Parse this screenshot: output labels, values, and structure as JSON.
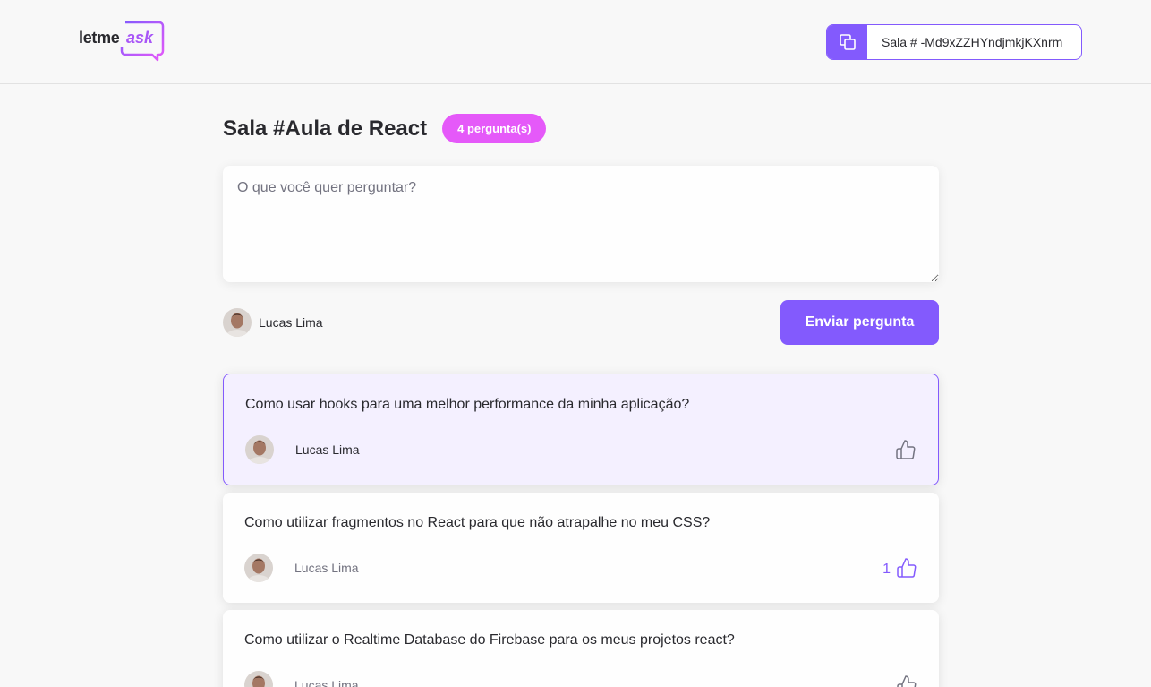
{
  "header": {
    "logo": {
      "part1": "letme",
      "part2": "ask"
    },
    "room_code": "Sala # -Md9xZZHYndjmkjKXnrm"
  },
  "room": {
    "title": "Sala #Aula de React",
    "question_count": "4 pergunta(s)"
  },
  "form": {
    "placeholder": "O que você quer perguntar?",
    "user_name": "Lucas Lima",
    "submit_label": "Enviar pergunta"
  },
  "questions": [
    {
      "content": "Como usar hooks para uma melhor performance da minha aplicação?",
      "author": "Lucas Lima",
      "likes": "",
      "highlighted": true
    },
    {
      "content": "Como utilizar fragmentos no React para que não atrapalhe no meu CSS?",
      "author": "Lucas Lima",
      "likes": "1",
      "liked": true
    },
    {
      "content": "Como utilizar o Realtime Database do Firebase para os meus projetos react?",
      "author": "Lucas Lima",
      "likes": ""
    }
  ],
  "colors": {
    "accent": "#835afd",
    "badge": "#e559f9",
    "highlight_bg": "#f4f0ff",
    "logo_accent": "#a855f7"
  },
  "icons": {
    "copy": "copy-icon",
    "like": "thumbs-up-icon",
    "logo_bubble": "speech-bubble-icon"
  }
}
